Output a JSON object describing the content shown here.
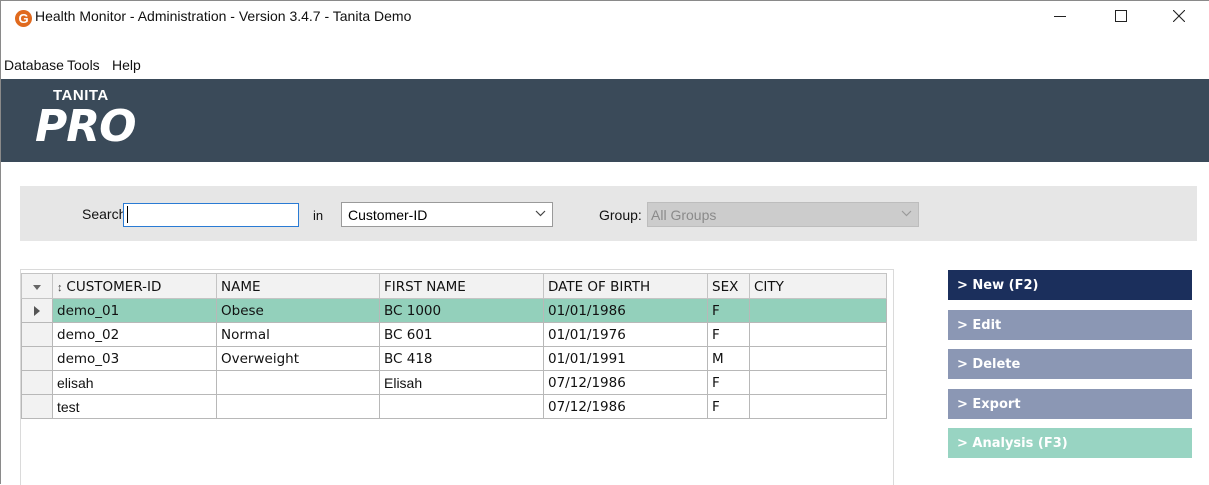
{
  "window": {
    "title": "Health Monitor - Administration - Version 3.4.7 - Tanita Demo",
    "app_icon_letter": "G",
    "controls": [
      "minimize-icon",
      "maximize-icon",
      "close-icon"
    ]
  },
  "menu": {
    "items": [
      {
        "label": "Database"
      },
      {
        "label": "Tools"
      },
      {
        "label": "Help"
      }
    ]
  },
  "banner": {
    "brand": "TANITA",
    "product": "PRO",
    "color": "#3a4a59"
  },
  "filter": {
    "search_label": "Search:",
    "search_value": "",
    "in_label": "in",
    "field_value": "Customer-ID",
    "group_label": "Group:",
    "group_value": "All Groups"
  },
  "table": {
    "columns": [
      "CUSTOMER-ID",
      "NAME",
      "FIRST NAME",
      "DATE OF BIRTH",
      "SEX",
      "CITY"
    ],
    "sort_indicator": "↕",
    "rows": [
      {
        "id": "demo_01",
        "name": "Obese",
        "first": "BC 1000",
        "dob": "01/01/1986",
        "sex": "F",
        "city": "",
        "selected": true
      },
      {
        "id": "demo_02",
        "name": "Normal",
        "first": "BC 601",
        "dob": "01/01/1976",
        "sex": "F",
        "city": ""
      },
      {
        "id": "demo_03",
        "name": "Overweight",
        "first": "BC 418",
        "dob": "01/01/1991",
        "sex": "M",
        "city": ""
      },
      {
        "id": "elisah",
        "name": "",
        "first": "Elisah",
        "dob": "07/12/1986",
        "sex": "F",
        "city": ""
      },
      {
        "id": "test",
        "name": "",
        "first": "",
        "dob": "07/12/1986",
        "sex": "F",
        "city": ""
      }
    ],
    "selected_row_color": "#93d0bb"
  },
  "actions": {
    "new": "> New (F2)",
    "edit": "> Edit",
    "delete": "> Delete",
    "export": "> Export",
    "analysis": "> Analysis (F3)",
    "colors": {
      "primary": "#1b2f5c",
      "secondary": "#8b97b4",
      "analysis": "#98d4c2"
    }
  }
}
